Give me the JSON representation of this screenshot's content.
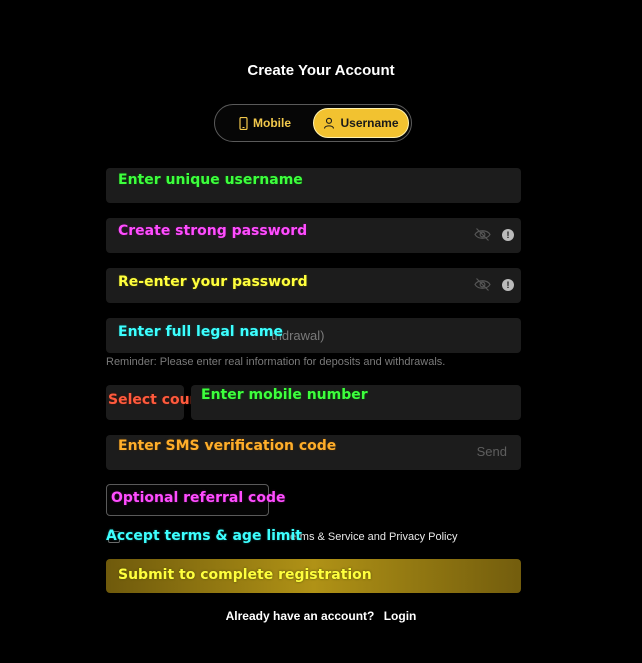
{
  "page": {
    "title": "Create Your Account"
  },
  "tabs": {
    "mobile": {
      "label": "Mobile",
      "icon": "phone-icon"
    },
    "username": {
      "label": "Username",
      "icon": "user-icon",
      "active": true
    }
  },
  "fields": {
    "username": {
      "annotation": "Enter unique username"
    },
    "password": {
      "annotation": "Create strong password",
      "icons": [
        "eye-slash-icon",
        "info-icon"
      ]
    },
    "confirm_password": {
      "annotation": "Re-enter your password",
      "icons": [
        "eye-slash-icon",
        "info-icon"
      ]
    },
    "full_name": {
      "annotation": "Enter full legal name",
      "partial_placeholder": "thdrawal)"
    },
    "reminder": "Reminder: Please enter real information for deposits and withdrawals.",
    "country_code": {
      "annotation": "Select country code"
    },
    "mobile_number": {
      "annotation": "Enter mobile number"
    },
    "sms_code": {
      "annotation": "Enter SMS verification code",
      "send_label": "Send"
    },
    "referral": {
      "annotation": "Optional referral code"
    }
  },
  "terms": {
    "annotation": "Accept terms & age limit",
    "text": "erms & Service and Privacy Policy"
  },
  "submit": {
    "annotation": "Submit to complete registration"
  },
  "login": {
    "prompt": "Already have an account?",
    "link": "Login"
  },
  "colors": {
    "accent": "#f2c230",
    "background": "#000000",
    "field": "#1c1c1c"
  }
}
